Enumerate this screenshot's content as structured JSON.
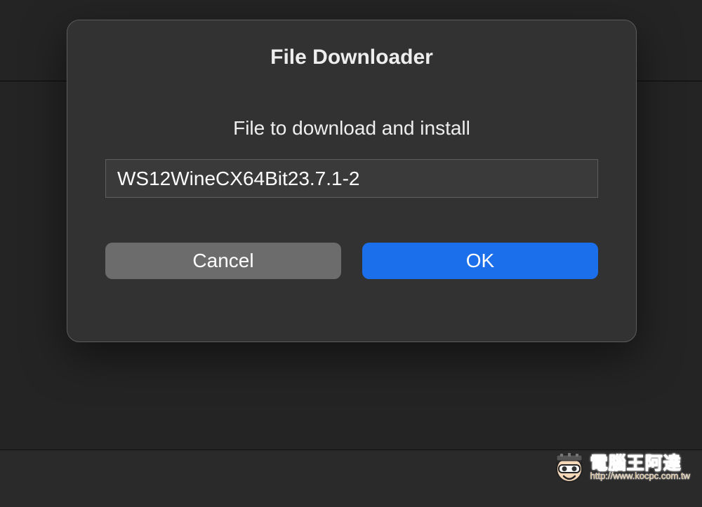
{
  "dialog": {
    "title": "File Downloader",
    "message": "File to download and install",
    "filename": "WS12WineCX64Bit23.7.1-2",
    "buttons": {
      "cancel": "Cancel",
      "ok": "OK"
    }
  },
  "watermark": {
    "brand": "電腦王阿達",
    "url": "http://www.kocpc.com.tw"
  }
}
